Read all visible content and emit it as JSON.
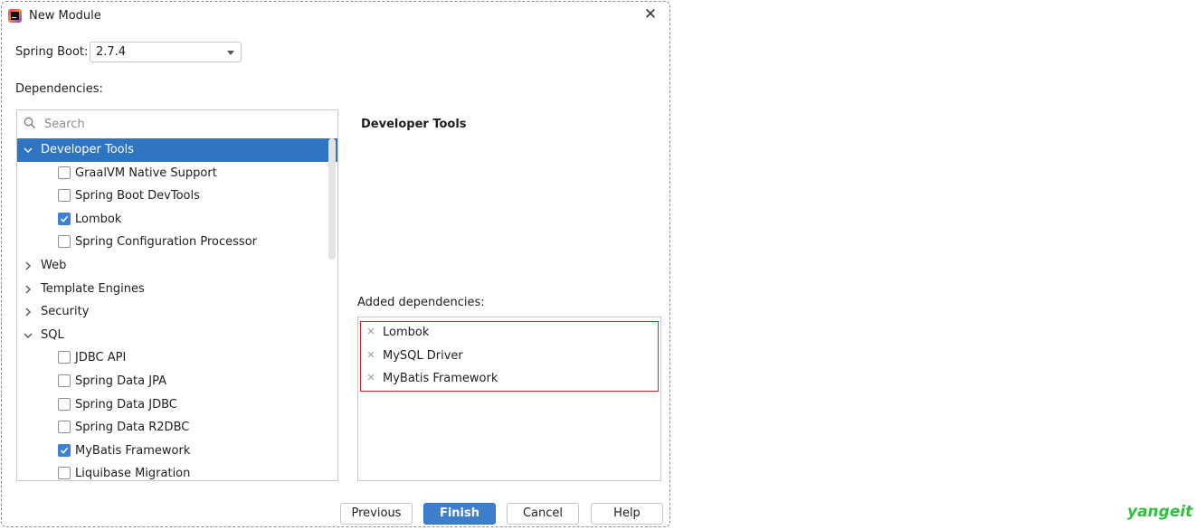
{
  "window": {
    "title": "New Module"
  },
  "spring_boot": {
    "label": "Spring Boot:",
    "value": "2.7.4"
  },
  "dependencies_label": "Dependencies:",
  "search": {
    "placeholder": "Search"
  },
  "tree": [
    {
      "type": "category",
      "label": "Developer Tools",
      "expanded": true,
      "selected": true
    },
    {
      "type": "item",
      "label": "GraalVM Native Support",
      "checked": false
    },
    {
      "type": "item",
      "label": "Spring Boot DevTools",
      "checked": false
    },
    {
      "type": "item",
      "label": "Lombok",
      "checked": true
    },
    {
      "type": "item",
      "label": "Spring Configuration Processor",
      "checked": false
    },
    {
      "type": "category",
      "label": "Web",
      "expanded": false
    },
    {
      "type": "category",
      "label": "Template Engines",
      "expanded": false
    },
    {
      "type": "category",
      "label": "Security",
      "expanded": false
    },
    {
      "type": "category",
      "label": "SQL",
      "expanded": true
    },
    {
      "type": "item",
      "label": "JDBC API",
      "checked": false
    },
    {
      "type": "item",
      "label": "Spring Data JPA",
      "checked": false
    },
    {
      "type": "item",
      "label": "Spring Data JDBC",
      "checked": false
    },
    {
      "type": "item",
      "label": "Spring Data R2DBC",
      "checked": false
    },
    {
      "type": "item",
      "label": "MyBatis Framework",
      "checked": true
    },
    {
      "type": "item",
      "label": "Liquibase Migration",
      "checked": false
    }
  ],
  "detail": {
    "title": "Developer Tools"
  },
  "added": {
    "label": "Added dependencies:",
    "items": [
      "Lombok",
      "MySQL Driver",
      "MyBatis Framework"
    ]
  },
  "buttons": {
    "previous": "Previous",
    "finish": "Finish",
    "cancel": "Cancel",
    "help": "Help"
  },
  "watermark": "yangeit",
  "colors": {
    "selection": "#2f74c0",
    "primary_button": "#3d7fcc",
    "highlight_border": "#e0202a",
    "checkbox_on": "#3d80d6",
    "watermark": "#2fbf3f"
  }
}
